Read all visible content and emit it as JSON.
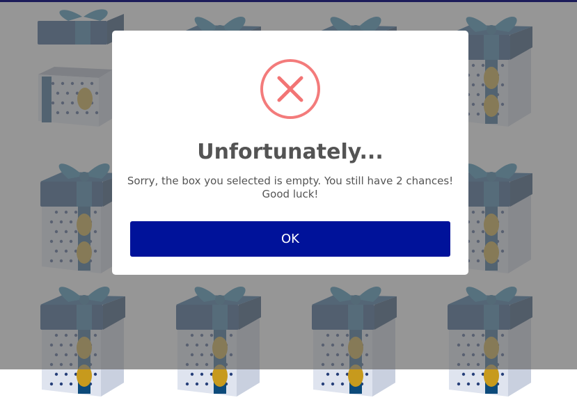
{
  "dialog": {
    "icon": "error-x-icon",
    "title": "Unfortunately...",
    "message": "Sorry, the box you selected is empty. You still have 2 chances! Good luck!",
    "ok_label": "OK"
  },
  "gifts": [
    {
      "state": "opened"
    },
    {
      "state": "closed"
    },
    {
      "state": "closed"
    },
    {
      "state": "closed"
    },
    {
      "state": "closed"
    },
    {
      "state": "closed"
    },
    {
      "state": "closed"
    },
    {
      "state": "closed"
    },
    {
      "state": "closed"
    },
    {
      "state": "closed"
    },
    {
      "state": "closed"
    },
    {
      "state": "closed"
    }
  ],
  "colors": {
    "accent": "#00129a",
    "error": "#f27474",
    "gift_box": "#dfe4ef",
    "gift_ribbon": "#0c4a7a",
    "gift_lid": "#0d3b73",
    "gift_medallion": "#c79a1d",
    "overlay": "#6e6e6e"
  }
}
